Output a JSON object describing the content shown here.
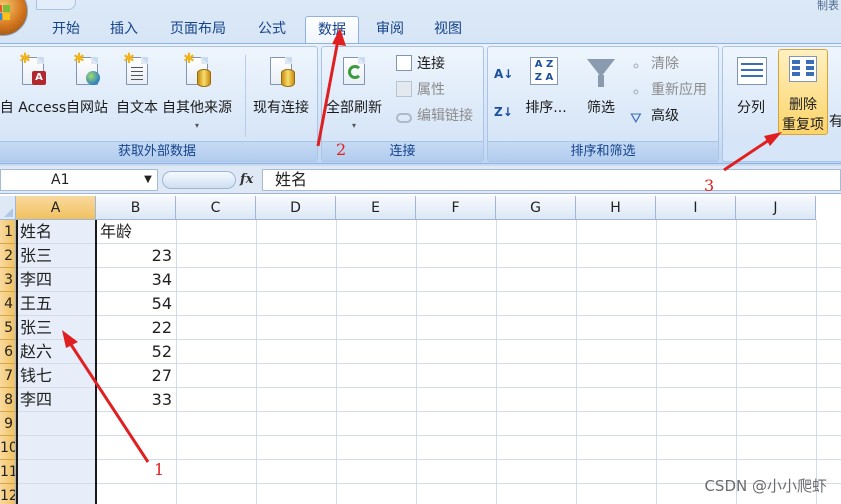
{
  "title_right": "制表",
  "tabs": [
    {
      "label": "开始",
      "active": false
    },
    {
      "label": "插入",
      "active": false
    },
    {
      "label": "页面布局",
      "active": false
    },
    {
      "label": "公式",
      "active": false
    },
    {
      "label": "数据",
      "active": true
    },
    {
      "label": "审阅",
      "active": false
    },
    {
      "label": "视图",
      "active": false
    }
  ],
  "ribbon": {
    "get_external": {
      "label": "获取外部数据",
      "buttons": [
        "自 Access",
        "自网站",
        "自文本",
        "自其他来源",
        "现有连接"
      ]
    },
    "connections": {
      "label": "连接",
      "refresh_all": "全部刷新",
      "items": [
        "连接",
        "属性",
        "编辑链接"
      ]
    },
    "sort_filter": {
      "label": "排序和筛选",
      "sort": "排序...",
      "filter": "筛选",
      "items": [
        "清除",
        "重新应用",
        "高级"
      ]
    },
    "data_tools": {
      "split": "分列",
      "remove_dup_line1": "删除",
      "remove_dup_line2": "重复项",
      "more_label": "有"
    }
  },
  "formula_bar": {
    "name_box": "A1",
    "fx": "fx",
    "value": "姓名"
  },
  "columns": [
    "A",
    "B",
    "C",
    "D",
    "E",
    "F",
    "G",
    "H",
    "I",
    "J"
  ],
  "rows": [
    "1",
    "2",
    "3",
    "4",
    "5",
    "6",
    "7",
    "8",
    "9",
    "10",
    "11",
    "12"
  ],
  "cells": [
    [
      "姓名",
      "年龄"
    ],
    [
      "张三",
      "23"
    ],
    [
      "李四",
      "34"
    ],
    [
      "王五",
      "54"
    ],
    [
      "张三",
      "22"
    ],
    [
      "赵六",
      "52"
    ],
    [
      "钱七",
      "27"
    ],
    [
      "李四",
      "33"
    ]
  ],
  "annotations": {
    "step1": "1",
    "step2": "2",
    "step3": "3",
    "arrow_color": "#e02020"
  },
  "watermark": "CSDN @小小爬虾"
}
